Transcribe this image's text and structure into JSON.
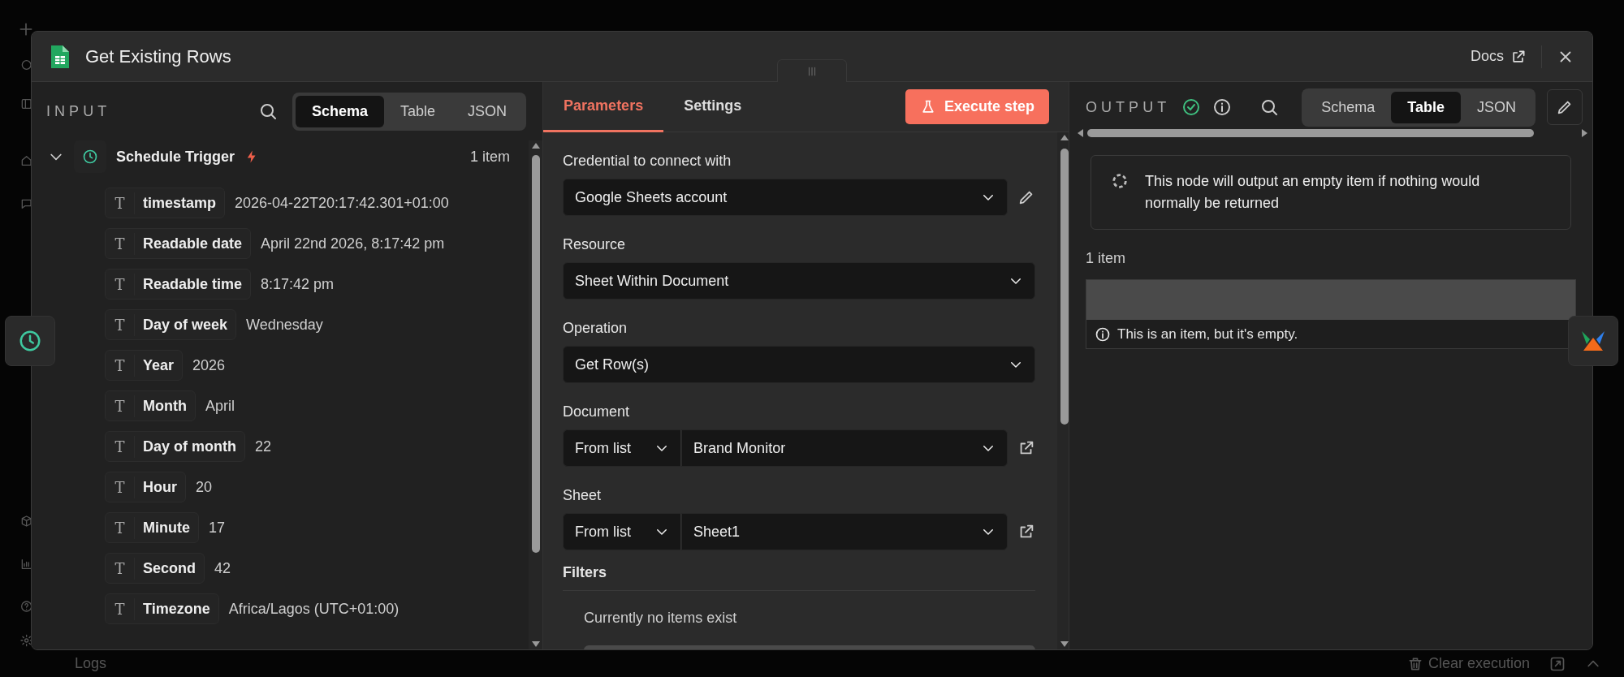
{
  "modal": {
    "title": "Get Existing Rows",
    "docs_link": "Docs"
  },
  "input": {
    "heading": "INPUT",
    "view_tabs": [
      {
        "label": "Schema",
        "selected": true
      },
      {
        "label": "Table",
        "selected": false
      },
      {
        "label": "JSON",
        "selected": false
      }
    ],
    "node": {
      "name": "Schedule Trigger",
      "count": "1 item",
      "expanded": true,
      "fields": [
        {
          "type_icon": "T",
          "key": "timestamp",
          "value": "2026-04-22T20:17:42.301+01:00"
        },
        {
          "type_icon": "T",
          "key": "Readable date",
          "value": "April 22nd 2026, 8:17:42 pm"
        },
        {
          "type_icon": "T",
          "key": "Readable time",
          "value": "8:17:42 pm"
        },
        {
          "type_icon": "T",
          "key": "Day of week",
          "value": "Wednesday"
        },
        {
          "type_icon": "T",
          "key": "Year",
          "value": "2026"
        },
        {
          "type_icon": "T",
          "key": "Month",
          "value": "April"
        },
        {
          "type_icon": "T",
          "key": "Day of month",
          "value": "22"
        },
        {
          "type_icon": "T",
          "key": "Hour",
          "value": "20"
        },
        {
          "type_icon": "T",
          "key": "Minute",
          "value": "17"
        },
        {
          "type_icon": "T",
          "key": "Second",
          "value": "42"
        },
        {
          "type_icon": "T",
          "key": "Timezone",
          "value": "Africa/Lagos (UTC+01:00)"
        }
      ]
    }
  },
  "parameters": {
    "tabs": [
      {
        "label": "Parameters",
        "selected": true
      },
      {
        "label": "Settings",
        "selected": false
      }
    ],
    "execute_button": "Execute step",
    "fields": [
      {
        "kind": "credential",
        "label": "Credential to connect with",
        "value": "Google Sheets account"
      },
      {
        "kind": "select",
        "label": "Resource",
        "value": "Sheet Within Document"
      },
      {
        "kind": "select",
        "label": "Operation",
        "value": "Get Row(s)"
      },
      {
        "kind": "list_select",
        "label": "Document",
        "mode": "From list",
        "value": "Brand Monitor"
      },
      {
        "kind": "list_select",
        "label": "Sheet",
        "mode": "From list",
        "value": "Sheet1"
      }
    ],
    "filters": {
      "label": "Filters",
      "empty_text": "Currently no items exist"
    }
  },
  "output": {
    "heading": "OUTPUT",
    "view_tabs": [
      {
        "label": "Schema",
        "selected": false
      },
      {
        "label": "Table",
        "selected": true
      },
      {
        "label": "JSON",
        "selected": false
      }
    ],
    "notice": "This node will output an empty item if nothing would normally be returned",
    "count": "1 item",
    "empty_item_text": "This is an item, but it's empty."
  },
  "bottom_bar": {
    "logs_label": "Logs",
    "clear_button": "Clear execution"
  }
}
